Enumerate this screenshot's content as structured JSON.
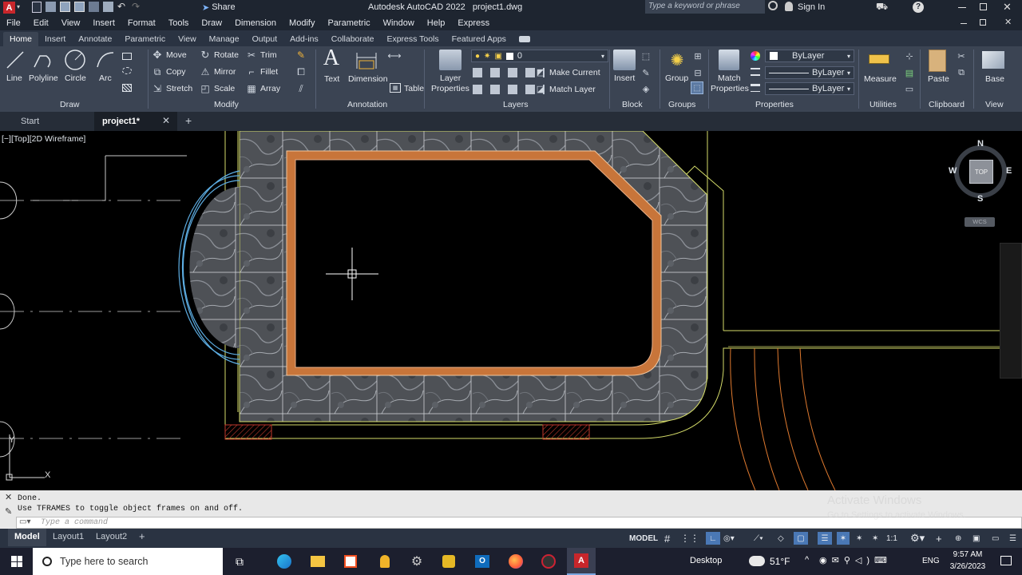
{
  "titlebar": {
    "share": "Share",
    "title": "Autodesk AutoCAD 2022",
    "file": "project1.dwg",
    "search_placeholder": "Type a keyword or phrase",
    "signin": "Sign In"
  },
  "menubar": [
    "File",
    "Edit",
    "View",
    "Insert",
    "Format",
    "Tools",
    "Draw",
    "Dimension",
    "Modify",
    "Parametric",
    "Window",
    "Help",
    "Express"
  ],
  "ribbon_tabs": [
    "Home",
    "Insert",
    "Annotate",
    "Parametric",
    "View",
    "Manage",
    "Output",
    "Add-ins",
    "Collaborate",
    "Express Tools",
    "Featured Apps"
  ],
  "ribbon": {
    "draw": {
      "line": "Line",
      "polyline": "Polyline",
      "circle": "Circle",
      "arc": "Arc",
      "panel": "Draw"
    },
    "modify": {
      "move": "Move",
      "rotate": "Rotate",
      "trim": "Trim",
      "copy": "Copy",
      "mirror": "Mirror",
      "fillet": "Fillet",
      "stretch": "Stretch",
      "scale": "Scale",
      "array": "Array",
      "panel": "Modify"
    },
    "annotation": {
      "text": "Text",
      "dimension": "Dimension",
      "table": "Table",
      "panel": "Annotation"
    },
    "layers": {
      "layer_props_1": "Layer",
      "layer_props_2": "Properties",
      "current_layer": "0",
      "make_current": "Make Current",
      "match_layer": "Match Layer",
      "panel": "Layers"
    },
    "block": {
      "insert": "Insert",
      "panel": "Block"
    },
    "groups": {
      "group": "Group",
      "panel": "Groups"
    },
    "properties": {
      "match_1": "Match",
      "match_2": "Properties",
      "color": "ByLayer",
      "linetype": "ByLayer",
      "lineweight": "ByLayer",
      "panel": "Properties"
    },
    "utilities": {
      "measure": "Measure",
      "panel": "Utilities"
    },
    "clipboard": {
      "paste": "Paste",
      "panel": "Clipboard"
    },
    "view": {
      "base": "Base",
      "panel": "View"
    }
  },
  "doctabs": {
    "start": "Start",
    "project": "project1*"
  },
  "viewport": {
    "label": "[−][Top][2D Wireframe]",
    "compass": {
      "n": "N",
      "s": "S",
      "e": "E",
      "w": "W",
      "top": "TOP",
      "wcs": "WCS"
    }
  },
  "command": {
    "history": [
      "Done.",
      "Use TFRAMES to toggle object frames on and off."
    ],
    "placeholder": "Type a command"
  },
  "watermark": {
    "line1": "Activate Windows",
    "line2": "Go to Settings to activate Windows."
  },
  "layout_tabs": [
    "Model",
    "Layout1",
    "Layout2"
  ],
  "status": {
    "model": "MODEL",
    "scale": "1:1"
  },
  "taskbar": {
    "search": "Type here to search",
    "desktop": "Desktop",
    "temp": "51°F",
    "lang": "ENG",
    "time": "9:57 AM",
    "date": "3/26/2023"
  },
  "colors": {
    "accent": "#c0392b",
    "tile_trim": "#c8753a",
    "yellow_line": "#d6dd6a",
    "orange_line": "#e07a2f"
  }
}
